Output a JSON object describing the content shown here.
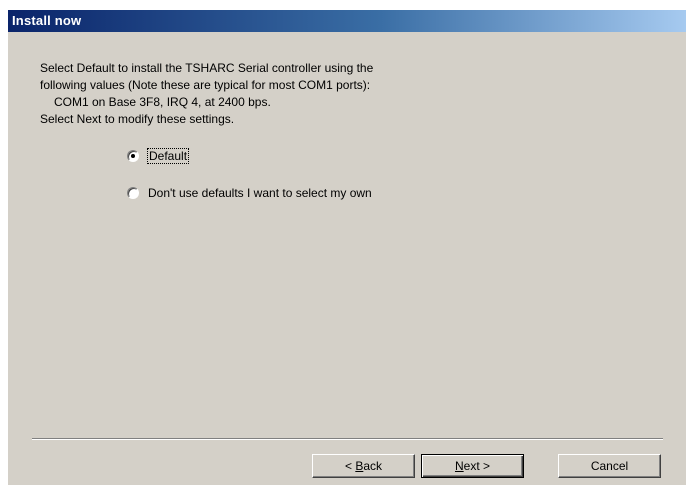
{
  "window": {
    "title": "Install now"
  },
  "intro": {
    "line1": "Select Default to install the TSHARC Serial controller using the",
    "line2": "following values (Note these are typical for most COM1 ports):",
    "line3": "COM1 on Base 3F8, IRQ 4, at 2400 bps.",
    "line4": "Select Next to modify these settings."
  },
  "options": {
    "default_label": "Default",
    "default_selected": true,
    "custom_label": "Don't use defaults I want to select my own",
    "custom_selected": false
  },
  "buttons": {
    "back_prefix": "< ",
    "back_mnemonic": "B",
    "back_rest": "ack",
    "next_mnemonic": "N",
    "next_rest": "ext >",
    "cancel_label": "Cancel"
  }
}
